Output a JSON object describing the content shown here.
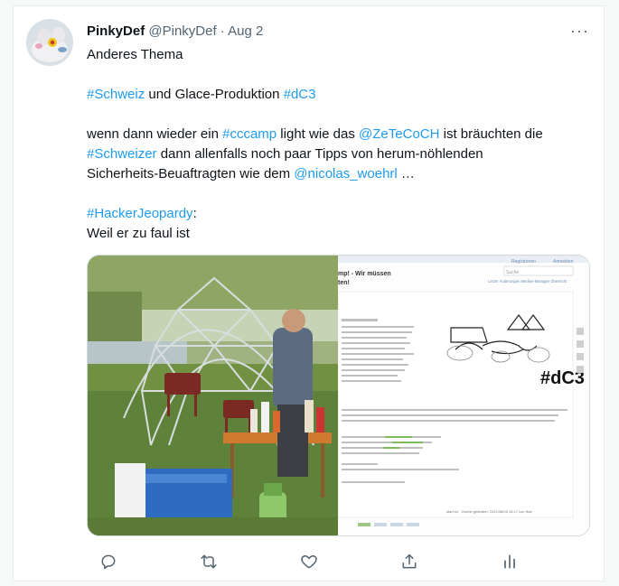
{
  "tweet": {
    "display_name": "PinkyDef",
    "handle": "@PinkyDef",
    "separator": " · ",
    "date": "Aug 2",
    "more_label": "···",
    "lines": {
      "l1": "Anderes Thema",
      "l2_a": "#Schweiz",
      "l2_b": " und Glace-Produktion ",
      "l2_c": "#dC3",
      "l3_a": "wenn dann wieder ein ",
      "l3_b": "#cccamp",
      "l3_c": " light wie das ",
      "l3_d": "@ZeTeCoCH",
      "l3_e": " ist bräuchten die",
      "l4_a": "#Schweizer",
      "l4_b": " dann allenfalls  noch paar Tipps von herum-nöhlenden",
      "l5_a": "Sicherheits-Beuaftragten wie dem ",
      "l5_b": "@nicolas_woehrl",
      "l5_c": " …",
      "l6_a": "#HackerJeopardy",
      "l6_b": ":",
      "l7": "Weil er zu faul ist"
    }
  },
  "screenshot_image": {
    "logo_text": "#dC3",
    "title_fragment": "mp! - Wir müssen",
    "title_fragment_2": "ten!",
    "nav_register": "Registrieren",
    "nav_login": "Anmelden",
    "search_placeholder": "Suche",
    "links": "Letzte Änderungen   Medien-Manager   Übersicht",
    "footer_text": "start.txt · Zuletzt geändert: 2021/08/05 16:17 von flow"
  },
  "colors": {
    "link": "#1d9bf0",
    "text": "#0f1419",
    "muted": "#536471"
  },
  "icons": [
    "reply-icon",
    "retweet-icon",
    "like-icon",
    "share-icon",
    "analytics-icon"
  ]
}
